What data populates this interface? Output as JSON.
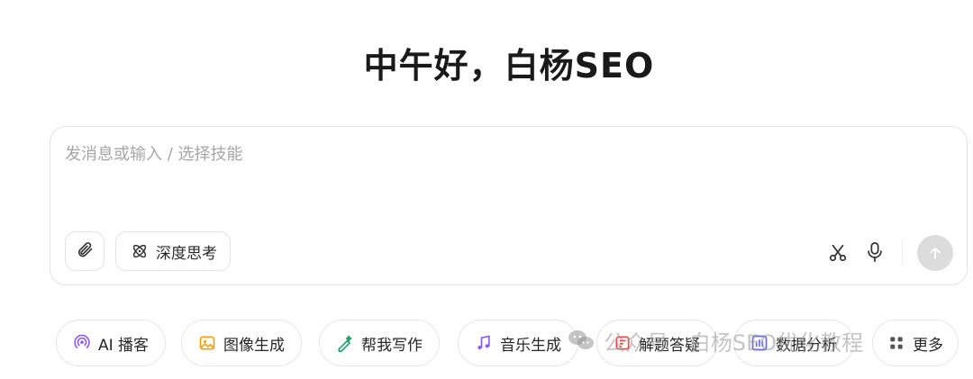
{
  "greeting": "中午好，白杨SEO",
  "composer": {
    "placeholder": "发消息或输入 / 选择技能",
    "deep_think_label": "深度思考"
  },
  "chips": [
    {
      "label": "AI 播客",
      "icon": "podcast-icon",
      "color": "#8b5cf6"
    },
    {
      "label": "图像生成",
      "icon": "image-icon",
      "color": "#f59e0b"
    },
    {
      "label": "帮我写作",
      "icon": "write-icon",
      "color": "#22a06b"
    },
    {
      "label": "音乐生成",
      "icon": "music-icon",
      "color": "#8b5cf6"
    },
    {
      "label": "解题答疑",
      "icon": "solve-icon",
      "color": "#ef4444"
    },
    {
      "label": "数据分析",
      "icon": "chart-icon",
      "color": "#6366f1"
    },
    {
      "label": "更多",
      "icon": "more-icon",
      "color": "#555555"
    }
  ],
  "watermark": {
    "text": "公众号 · 白杨SEO优化教程"
  }
}
